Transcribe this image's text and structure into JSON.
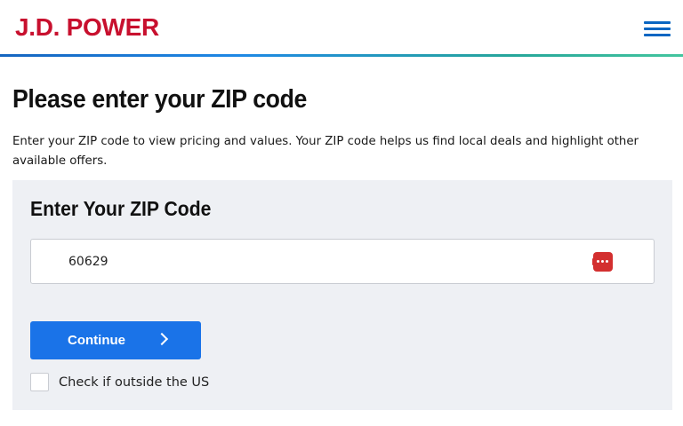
{
  "header": {
    "logo_text": "J.D. POWER",
    "menu_icon": "hamburger-menu-icon",
    "brand_color": "#c8102e",
    "accent_color": "#0a66c2"
  },
  "main": {
    "title": "Please enter your ZIP code",
    "description": "Enter your ZIP code to view pricing and values. Your ZIP code helps us find local deals and highlight other available offers."
  },
  "zip_panel": {
    "title": "Enter Your ZIP Code",
    "zip_value": "60629",
    "password_manager_icon": "password-manager-icon",
    "continue_label": "Continue",
    "continue_icon": "chevron-right-icon",
    "button_color": "#1a73e8",
    "outside_us_label": "Check if outside the US",
    "outside_us_checked": false
  }
}
